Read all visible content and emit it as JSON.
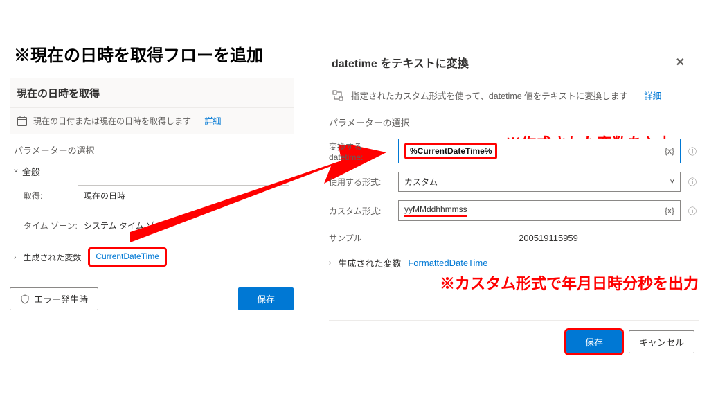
{
  "main_annotation": "※現在の日時を取得フローを追加",
  "annotations": {
    "created_var": "※作成された変数を入力",
    "custom_fmt": "※カスタム形式で年月日時分秒を出力"
  },
  "left": {
    "title": "現在の日時を取得",
    "desc": "現在の日付または現在の日時を取得します",
    "more": "詳細",
    "section_param": "パラメーターの選択",
    "general": "全般",
    "fields": {
      "retrieve": {
        "label": "取得:",
        "value": "現在の日時"
      },
      "timezone": {
        "label": "タイム ゾーン:",
        "value": "システム タイム ゾーン"
      }
    },
    "generated_label": "生成された変数",
    "generated_var": "CurrentDateTime",
    "on_error": "エラー発生時",
    "save": "保存"
  },
  "right": {
    "title": "datetime をテキストに変換",
    "desc": "指定されたカスタム形式を使って、datetime 値をテキストに変換します",
    "more": "詳細",
    "section_param": "パラメーターの選択",
    "fields": {
      "datetime": {
        "label": "変換する datetime:",
        "value": "%CurrentDateTime%"
      },
      "format": {
        "label": "使用する形式:",
        "value": "カスタム"
      },
      "custom": {
        "label": "カスタム形式:",
        "value": "yyMMddhhmmss"
      }
    },
    "sample": {
      "label": "サンプル",
      "value": "200519115959"
    },
    "generated_label": "生成された変数",
    "generated_var": "FormattedDateTime",
    "save": "保存",
    "cancel": "キャンセル"
  },
  "icons": {
    "info": "ⓘ",
    "var": "{x}",
    "chev_down": "˅",
    "caret_down": "˅",
    "caret_right": "›"
  }
}
